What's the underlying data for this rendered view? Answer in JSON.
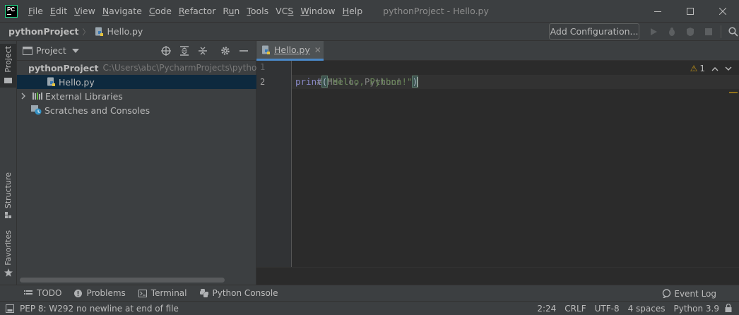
{
  "app": {
    "logo": "PC",
    "window_title": "pythonProject - Hello.py"
  },
  "menu": [
    {
      "pre": "",
      "u": "F",
      "post": "ile"
    },
    {
      "pre": "",
      "u": "E",
      "post": "dit"
    },
    {
      "pre": "",
      "u": "V",
      "post": "iew"
    },
    {
      "pre": "",
      "u": "N",
      "post": "avigate"
    },
    {
      "pre": "",
      "u": "C",
      "post": "ode"
    },
    {
      "pre": "",
      "u": "R",
      "post": "efactor"
    },
    {
      "pre": "R",
      "u": "u",
      "post": "n"
    },
    {
      "pre": "",
      "u": "T",
      "post": "ools"
    },
    {
      "pre": "VC",
      "u": "S",
      "post": ""
    },
    {
      "pre": "",
      "u": "W",
      "post": "indow"
    },
    {
      "pre": "",
      "u": "H",
      "post": "elp"
    }
  ],
  "navbar": {
    "project": "pythonProject",
    "file": "Hello.py",
    "add_configuration": "Add Configuration..."
  },
  "left_stripe": {
    "project": "Project",
    "structure": "Structure",
    "favorites": "Favorites"
  },
  "project_panel": {
    "title": "Project",
    "root_name": "pythonProject",
    "root_path": "C:\\Users\\abc\\PycharmProjects\\pythonProject",
    "file": "Hello.py",
    "external_libraries": "External Libraries",
    "scratches": "Scratches and Consoles"
  },
  "editor": {
    "tab_label": "Hello.py",
    "line_numbers": [
      "1",
      "2"
    ],
    "line1_comment": "# Hello, Python!",
    "line2_func": "print",
    "line2_open": "(",
    "line2_string": "\"Hello, Python!\"",
    "line2_close": ")",
    "warning_count": "1"
  },
  "tool_windows": {
    "todo": "TODO",
    "problems": "Problems",
    "terminal": "Terminal",
    "python_console": "Python Console",
    "event_log": "Event Log"
  },
  "status": {
    "message": "PEP 8: W292 no newline at end of file",
    "position": "2:24",
    "line_sep": "CRLF",
    "encoding": "UTF-8",
    "indent": "4 spaces",
    "interpreter": "Python 3.9"
  },
  "colors": {
    "accent": "#4a88c7",
    "selection": "#0d293e",
    "warning": "#be9117",
    "logo_green": "#21d789"
  }
}
